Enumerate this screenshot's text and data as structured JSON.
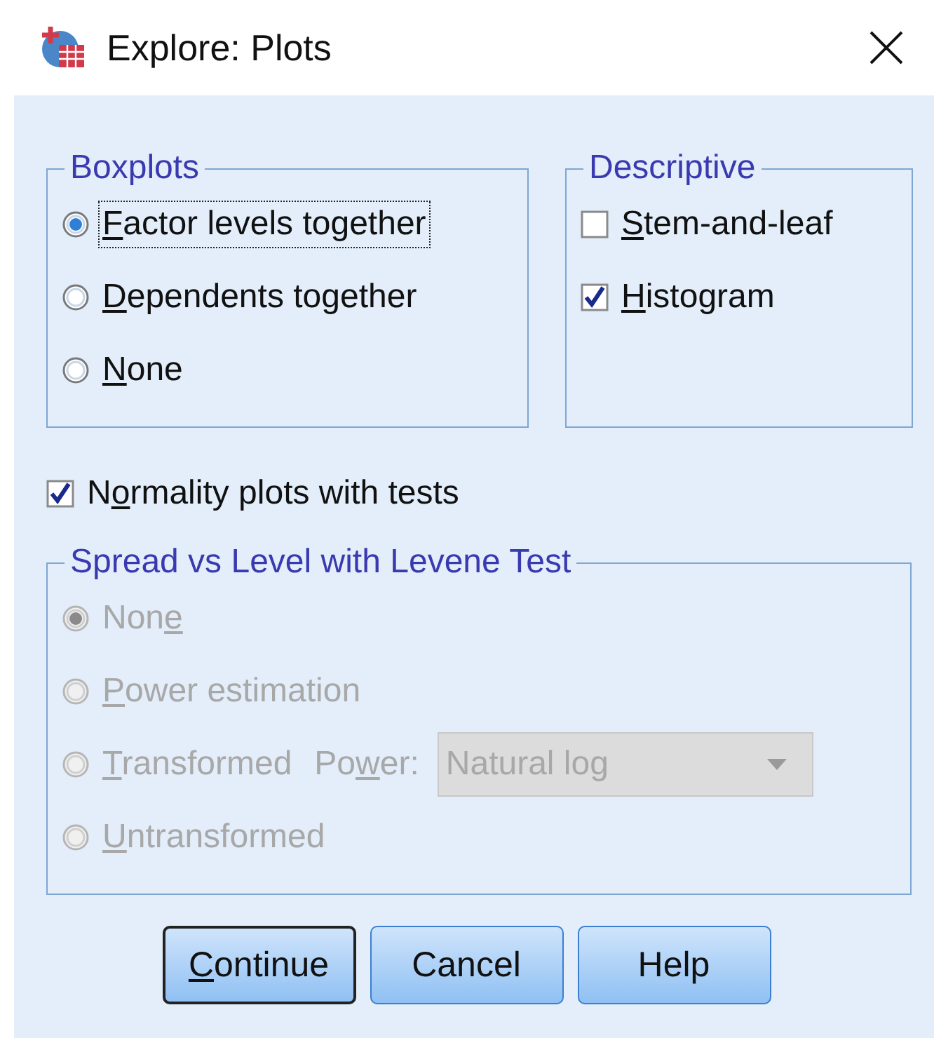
{
  "window": {
    "title": "Explore: Plots"
  },
  "boxplots": {
    "title": "Boxplots",
    "options": [
      {
        "label": {
          "key": "F",
          "after": "actor levels together"
        },
        "selected": true,
        "focused": true
      },
      {
        "label": {
          "key": "D",
          "after": "ependents together"
        },
        "selected": false,
        "focused": false
      },
      {
        "label": {
          "key": "N",
          "after": "one"
        },
        "selected": false,
        "focused": false
      }
    ]
  },
  "descriptive": {
    "title": "Descriptive",
    "options": [
      {
        "label": {
          "key": "S",
          "after": "tem-and-leaf"
        },
        "checked": false
      },
      {
        "label": {
          "key": "H",
          "after": "istogram"
        },
        "checked": true
      }
    ]
  },
  "normality": {
    "label": {
      "before": "N",
      "key": "o",
      "after": "rmality plots with tests"
    },
    "checked": true
  },
  "spread": {
    "title": "Spread vs Level with Levene Test",
    "disabled": true,
    "options": [
      {
        "kind": "plain",
        "label": {
          "before": "Non",
          "key": "e"
        },
        "selected": true
      },
      {
        "kind": "plain",
        "label": {
          "key": "P",
          "after": "ower estimation"
        },
        "selected": false
      },
      {
        "kind": "power",
        "label": {
          "key": "T",
          "after": "ransformed"
        },
        "selected": false,
        "power_label": {
          "before": "Po",
          "key": "w",
          "after": "er:"
        },
        "power_value": "Natural log"
      },
      {
        "kind": "plain",
        "label": {
          "key": "U",
          "after": "ntransformed"
        },
        "selected": false
      }
    ]
  },
  "buttons": [
    {
      "label": {
        "key": "C",
        "after": "ontinue"
      },
      "default": true
    },
    {
      "label": "Cancel",
      "default": false
    },
    {
      "label": "Help",
      "default": false
    }
  ]
}
